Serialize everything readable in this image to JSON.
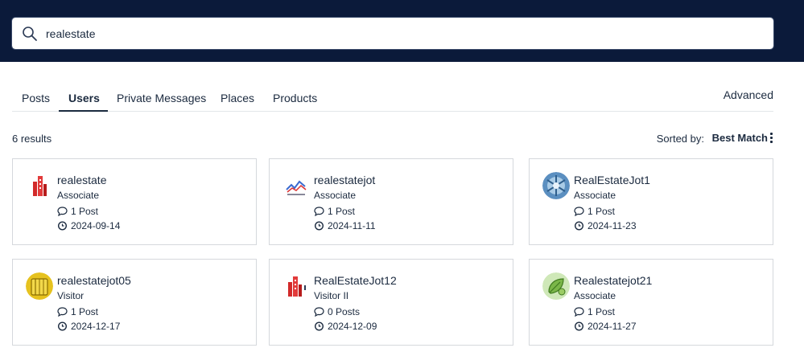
{
  "search": {
    "value": "realestate",
    "placeholder": ""
  },
  "tabs": [
    {
      "label": "Posts",
      "active": false
    },
    {
      "label": "Users",
      "active": true
    },
    {
      "label": "Private Messages",
      "active": false
    },
    {
      "label": "Places",
      "active": false
    },
    {
      "label": "Products",
      "active": false
    }
  ],
  "advanced_label": "Advanced",
  "results_count": "6 results",
  "sort": {
    "label": "Sorted by:",
    "value": "Best Match"
  },
  "users": [
    {
      "name": "realestate",
      "role": "Associate",
      "posts": "1 Post",
      "date": "2024-09-14",
      "avatar": "building-red-icon"
    },
    {
      "name": "realestatejot",
      "role": "Associate",
      "posts": "1 Post",
      "date": "2024-11-11",
      "avatar": "chart-logo-icon"
    },
    {
      "name": "RealEstateJot1",
      "role": "Associate",
      "posts": "1 Post",
      "date": "2024-11-23",
      "avatar": "blue-pattern-icon"
    },
    {
      "name": "realestatejot05",
      "role": "Visitor",
      "posts": "1 Post",
      "date": "2024-12-17",
      "avatar": "yellow-book-icon"
    },
    {
      "name": "RealEstateJot12",
      "role": "Visitor II",
      "posts": "0 Posts",
      "date": "2024-12-09",
      "avatar": "building-red-icon"
    },
    {
      "name": "Realestatejot21",
      "role": "Associate",
      "posts": "1 Post",
      "date": "2024-11-27",
      "avatar": "green-leaf-icon"
    }
  ],
  "colors": {
    "header_bg": "#0b1a3a",
    "text": "#1b2a3f",
    "card_border": "#d5d8dc"
  }
}
